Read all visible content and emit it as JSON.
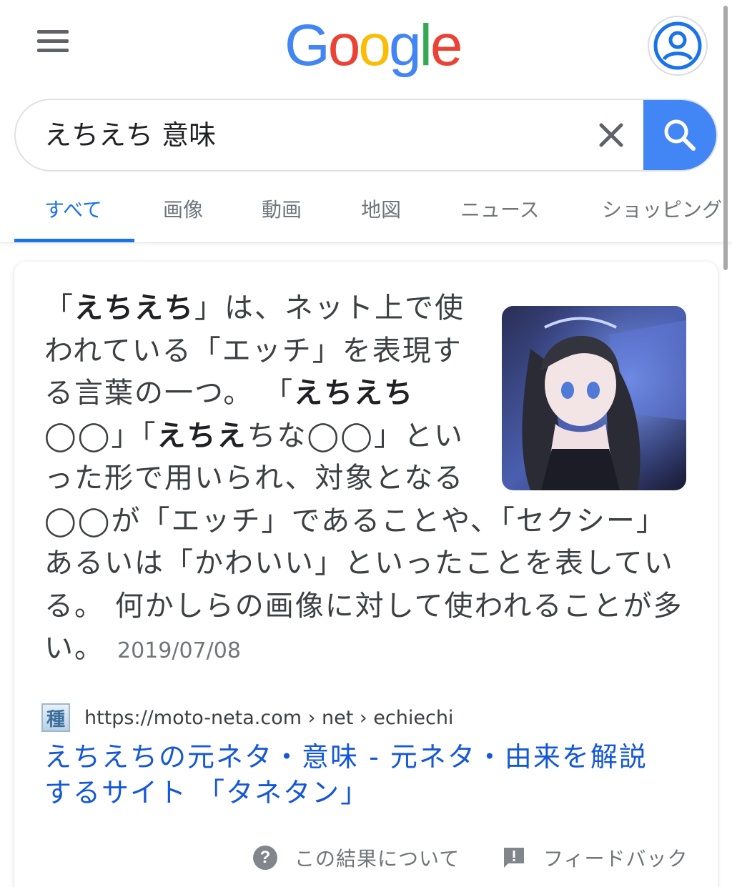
{
  "header": {
    "logo_letters": [
      {
        "ch": "G",
        "color": "#4285f4"
      },
      {
        "ch": "o",
        "color": "#ea4335"
      },
      {
        "ch": "o",
        "color": "#fbbc05"
      },
      {
        "ch": "g",
        "color": "#4285f4"
      },
      {
        "ch": "l",
        "color": "#34a853"
      },
      {
        "ch": "e",
        "color": "#ea4335"
      }
    ]
  },
  "search": {
    "query": "えちえち 意味"
  },
  "tabs": [
    {
      "label": "すべて",
      "active": true
    },
    {
      "label": "画像",
      "active": false
    },
    {
      "label": "動画",
      "active": false
    },
    {
      "label": "地図",
      "active": false
    },
    {
      "label": "ニュース",
      "active": false
    },
    {
      "label": "ショッピング",
      "active": false
    }
  ],
  "card": {
    "snippet_parts": [
      {
        "text": "「",
        "bold": false
      },
      {
        "text": "えちえち",
        "bold": true
      },
      {
        "text": "」は、ネット上で使われている「エッチ」を表現する言葉の一つ。 「",
        "bold": false
      },
      {
        "text": "えちえち",
        "bold": true
      },
      {
        "text": "◯◯」「",
        "bold": false
      },
      {
        "text": "えちえ",
        "bold": true
      },
      {
        "text": "ちな◯◯」といった形で用いられ、対象となる◯◯が「エッチ」であることや、「セクシー」あるいは「かわいい」といったことを表している。 何かしらの画像に対して使われることが多い。",
        "bold": false
      }
    ],
    "date": "2019/07/08",
    "favicon_char": "種",
    "source_url": "https://moto-neta.com › net › echiechi",
    "result_title": "えちえちの元ネタ・意味 - 元ネタ・由来を解説するサイト 「タネタン」",
    "about_label": "この結果について",
    "feedback_label": "フィードバック"
  },
  "colors": {
    "accent": "#1a73e8",
    "link": "#1558d6",
    "search_button": "#4285f4"
  },
  "icons": [
    "menu-icon",
    "account-icon",
    "clear-icon",
    "search-icon",
    "help-icon",
    "feedback-icon"
  ]
}
